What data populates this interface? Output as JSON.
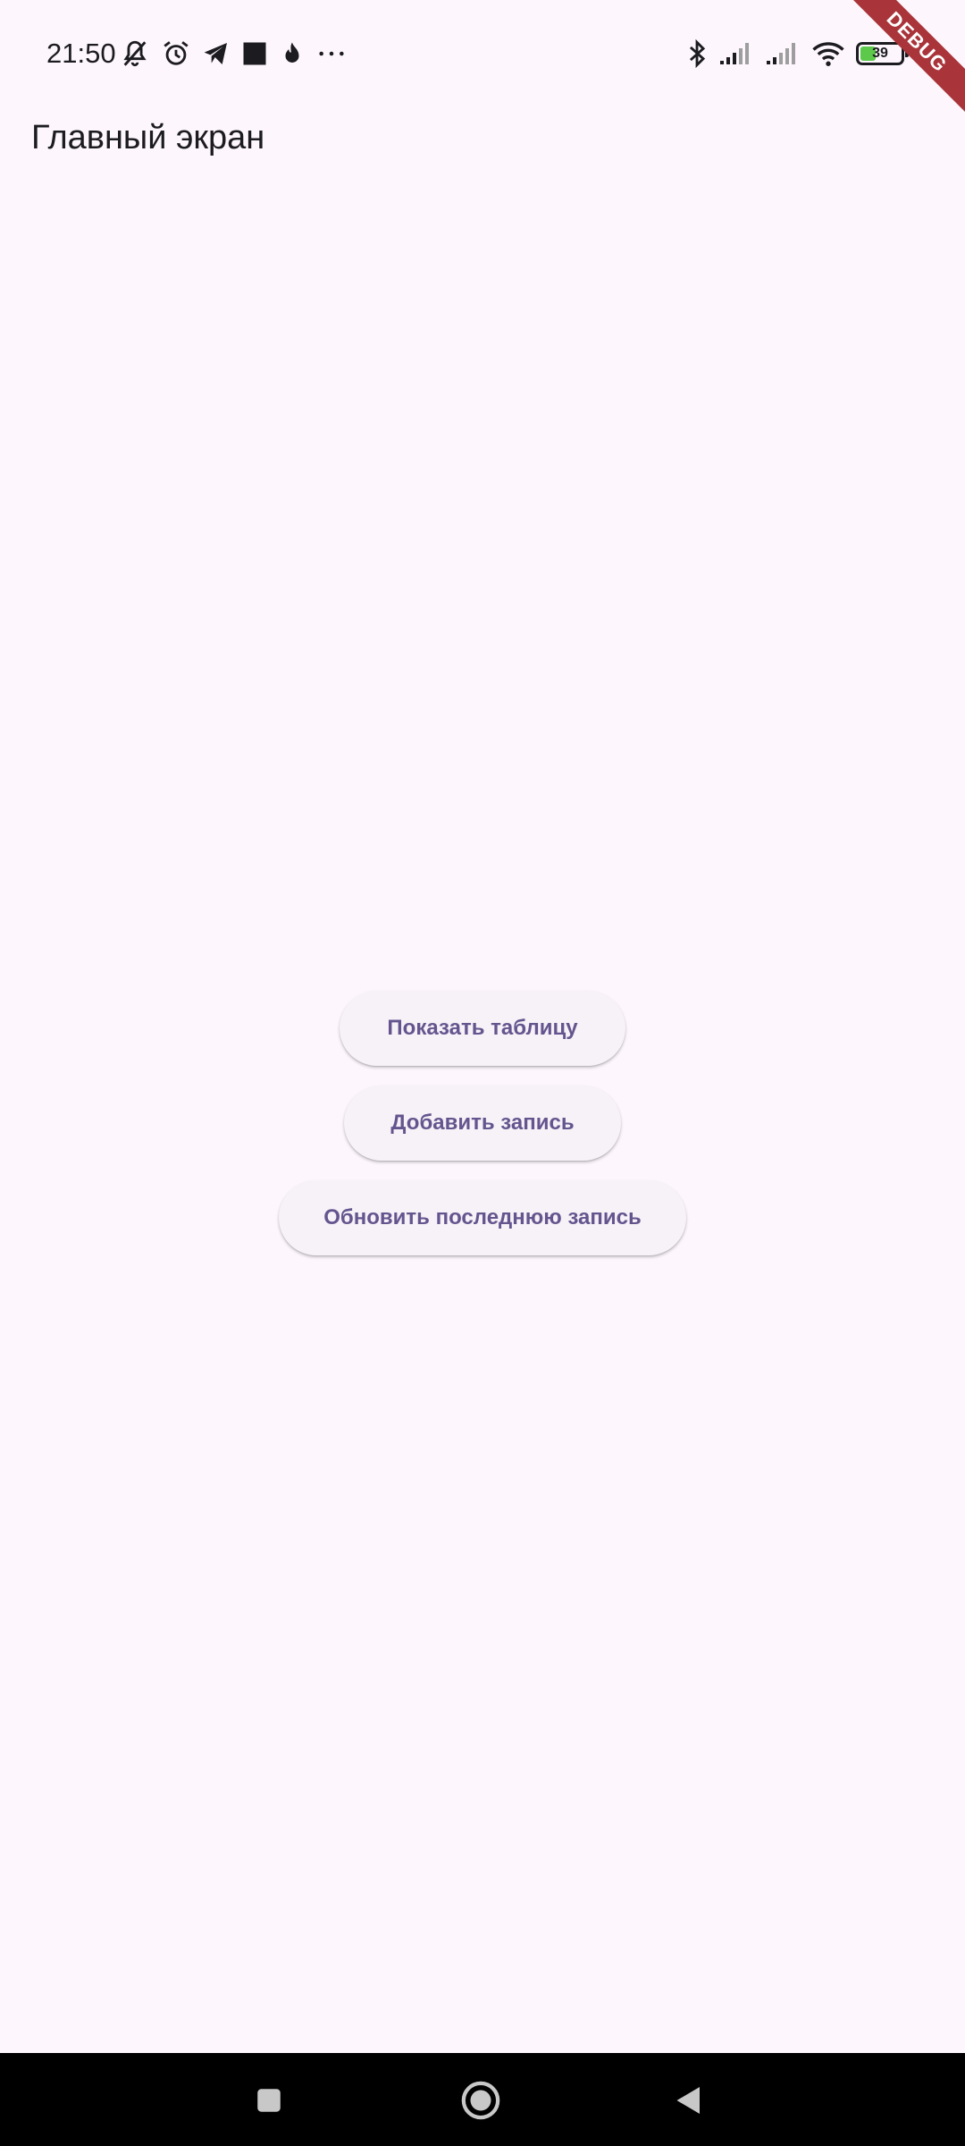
{
  "status_bar": {
    "time": "21:50",
    "battery_percent": "39",
    "battery_level": 0.39,
    "left_icons": [
      "muted-bell-icon",
      "alarm-icon",
      "telegram-icon",
      "square-icon",
      "flame-icon",
      "more-dots-icon"
    ],
    "right_icons": [
      "bluetooth-icon",
      "signal-icon",
      "signal-icon",
      "wifi-icon",
      "battery-icon",
      "charging-icon"
    ]
  },
  "debug_banner": {
    "label": "DEBUG",
    "color": "#a9343a"
  },
  "app_bar": {
    "title": "Главный экран"
  },
  "buttons": {
    "show_table": "Показать таблицу",
    "add_record": "Добавить запись",
    "update_last": "Обновить последнюю запись"
  },
  "nav_bar": {
    "items": [
      "recents-icon",
      "home-icon",
      "back-icon"
    ]
  },
  "colors": {
    "background": "#fdf7fd",
    "button_bg": "#f6f2f7",
    "button_text": "#65558f",
    "battery_fill": "#5cc94a"
  }
}
